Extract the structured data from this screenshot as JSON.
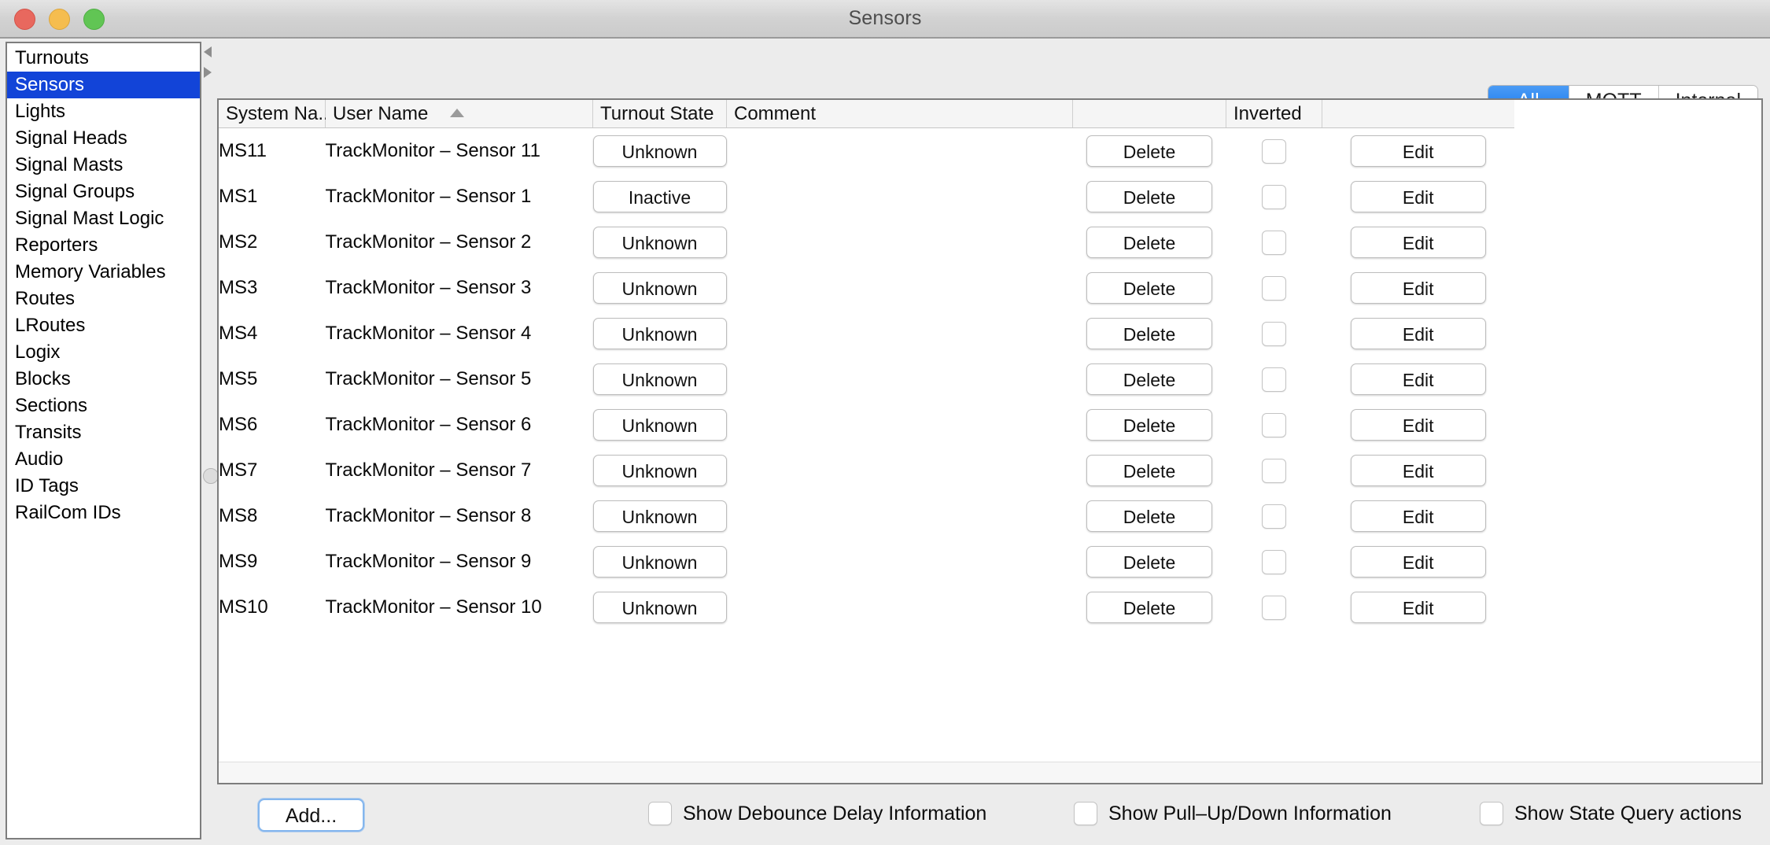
{
  "window": {
    "title": "Sensors",
    "traffic_lights": [
      "close-button",
      "minimize-button",
      "zoom-button"
    ]
  },
  "sidebar": {
    "items": [
      {
        "label": "Turnouts",
        "selected": false
      },
      {
        "label": "Sensors",
        "selected": true
      },
      {
        "label": "Lights",
        "selected": false
      },
      {
        "label": "Signal Heads",
        "selected": false
      },
      {
        "label": "Signal Masts",
        "selected": false
      },
      {
        "label": "Signal Groups",
        "selected": false
      },
      {
        "label": "Signal Mast Logic",
        "selected": false
      },
      {
        "label": "Reporters",
        "selected": false
      },
      {
        "label": "Memory Variables",
        "selected": false
      },
      {
        "label": "Routes",
        "selected": false
      },
      {
        "label": "LRoutes",
        "selected": false
      },
      {
        "label": "Logix",
        "selected": false
      },
      {
        "label": "Blocks",
        "selected": false
      },
      {
        "label": "Sections",
        "selected": false
      },
      {
        "label": "Transits",
        "selected": false
      },
      {
        "label": "Audio",
        "selected": false
      },
      {
        "label": "ID Tags",
        "selected": false
      },
      {
        "label": "RailCom IDs",
        "selected": false
      }
    ]
  },
  "tabs": {
    "selected": "All",
    "items": [
      {
        "label": "All",
        "active": true
      },
      {
        "label": "MQTT",
        "active": false
      },
      {
        "label": "Internal",
        "active": false
      }
    ],
    "accent_color": "#1374ee"
  },
  "table": {
    "columns": [
      {
        "label": "System Na...",
        "sort": ""
      },
      {
        "label": "User Name",
        "sort": "ascending"
      },
      {
        "label": "Turnout State",
        "sort": ""
      },
      {
        "label": "Comment",
        "sort": ""
      },
      {
        "label": "",
        "sort": ""
      },
      {
        "label": "Inverted",
        "sort": ""
      },
      {
        "label": "",
        "sort": ""
      }
    ],
    "rows": [
      {
        "system_name": "MS11",
        "user_name": "TrackMonitor – Sensor 11",
        "state": "Unknown",
        "comment": "",
        "delete": "Delete",
        "inverted": false,
        "edit": "Edit"
      },
      {
        "system_name": "MS1",
        "user_name": "TrackMonitor – Sensor 1",
        "state": "Inactive",
        "comment": "",
        "delete": "Delete",
        "inverted": false,
        "edit": "Edit"
      },
      {
        "system_name": "MS2",
        "user_name": "TrackMonitor – Sensor 2",
        "state": "Unknown",
        "comment": "",
        "delete": "Delete",
        "inverted": false,
        "edit": "Edit"
      },
      {
        "system_name": "MS3",
        "user_name": "TrackMonitor – Sensor 3",
        "state": "Unknown",
        "comment": "",
        "delete": "Delete",
        "inverted": false,
        "edit": "Edit"
      },
      {
        "system_name": "MS4",
        "user_name": "TrackMonitor – Sensor 4",
        "state": "Unknown",
        "comment": "",
        "delete": "Delete",
        "inverted": false,
        "edit": "Edit"
      },
      {
        "system_name": "MS5",
        "user_name": "TrackMonitor – Sensor 5",
        "state": "Unknown",
        "comment": "",
        "delete": "Delete",
        "inverted": false,
        "edit": "Edit"
      },
      {
        "system_name": "MS6",
        "user_name": "TrackMonitor – Sensor 6",
        "state": "Unknown",
        "comment": "",
        "delete": "Delete",
        "inverted": false,
        "edit": "Edit"
      },
      {
        "system_name": "MS7",
        "user_name": "TrackMonitor – Sensor 7",
        "state": "Unknown",
        "comment": "",
        "delete": "Delete",
        "inverted": false,
        "edit": "Edit"
      },
      {
        "system_name": "MS8",
        "user_name": "TrackMonitor – Sensor 8",
        "state": "Unknown",
        "comment": "",
        "delete": "Delete",
        "inverted": false,
        "edit": "Edit"
      },
      {
        "system_name": "MS9",
        "user_name": "TrackMonitor – Sensor 9",
        "state": "Unknown",
        "comment": "",
        "delete": "Delete",
        "inverted": false,
        "edit": "Edit"
      },
      {
        "system_name": "MS10",
        "user_name": "TrackMonitor – Sensor 10",
        "state": "Unknown",
        "comment": "",
        "delete": "Delete",
        "inverted": false,
        "edit": "Edit"
      }
    ]
  },
  "bottom_bar": {
    "add_label": "Add...",
    "checkboxes": [
      {
        "label": "Show Debounce Delay Information",
        "checked": false
      },
      {
        "label": "Show Pull–Up/Down Information",
        "checked": false
      },
      {
        "label": "Show State Query actions",
        "checked": false
      }
    ]
  }
}
